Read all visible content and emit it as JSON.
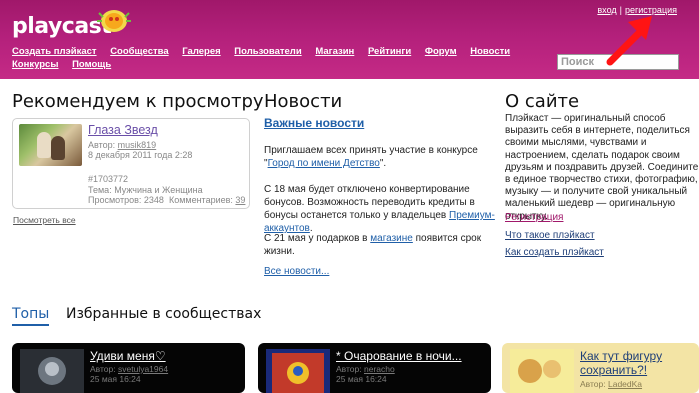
{
  "header": {
    "logo": "playcast",
    "login": "вход",
    "separator": "|",
    "register": "регистрация",
    "nav": [
      "Создать плэйкаст",
      "Сообщества",
      "Галерея",
      "Пользователи",
      "Магазин",
      "Рейтинги",
      "Форум",
      "Новости",
      "Конкурсы",
      "Помощь"
    ],
    "search_placeholder": "Поиск"
  },
  "recommend": {
    "title": "Рекомендуем к просмотру",
    "item": {
      "name": "Глаза Звезд",
      "author_label": "Автор:",
      "author": "musik819",
      "date": "8 декабря 2011 года 2:28",
      "id": "#1703772",
      "topic": "Тема: Мужчина и Женщина",
      "views_label": "Просмотров:",
      "views": "2348",
      "comments_label": "Комментариев:",
      "comments": "39"
    },
    "see_all": "Посмотреть все"
  },
  "news": {
    "title": "Новости",
    "important": "Важные новости",
    "p1_before": "Приглашаем всех принять участие в конкурсе \"",
    "p1_link": "Город по имени Детство",
    "p1_after": "\".",
    "p2": "С 18 мая будет отключено конвертирование бонусов. Возможность переводить кредиты в бонусы останется только у владельцев",
    "p2_link": "Премиум-аккаунтов",
    "p2_end": ".",
    "p3_before": "С 21 мая у подарков в",
    "p3_link": "магазине",
    "p3_after": "появится срок жизни.",
    "all": "Все новости..."
  },
  "about": {
    "title": "О сайте",
    "text": "Плэйкаст — оригинальный способ выразить себя в интернете, поделиться своими мыслями, чувствами и настроением, сделать подарок своим друзьям и поздравить друзей. Соедините в единое творчество стихи, фотографию, музыку — и получите свой уникальный маленький шедевр — оригинальную открытку.",
    "links": [
      "Регистрация",
      "Что такое плэйкаст",
      "Как создать плэйкаст"
    ]
  },
  "tabs": [
    "Топы",
    "Избранные в сообществах"
  ],
  "cards": [
    {
      "title": "Удиви меня♡",
      "author_label": "Автор:",
      "author": "svetulya1964",
      "date": "25 мая 16:24"
    },
    {
      "title": "* Очарование в ночи...",
      "author_label": "Автор:",
      "author": "neracho",
      "date": "25 мая 16:24"
    },
    {
      "title": "Как тут фигуру сохранить?!",
      "author_label": "Автор:",
      "author": "LadedKa",
      "date": ""
    }
  ],
  "colors": {
    "header": "#b3207b",
    "link": "#1f5fa8",
    "arrow": "#ff1414"
  }
}
